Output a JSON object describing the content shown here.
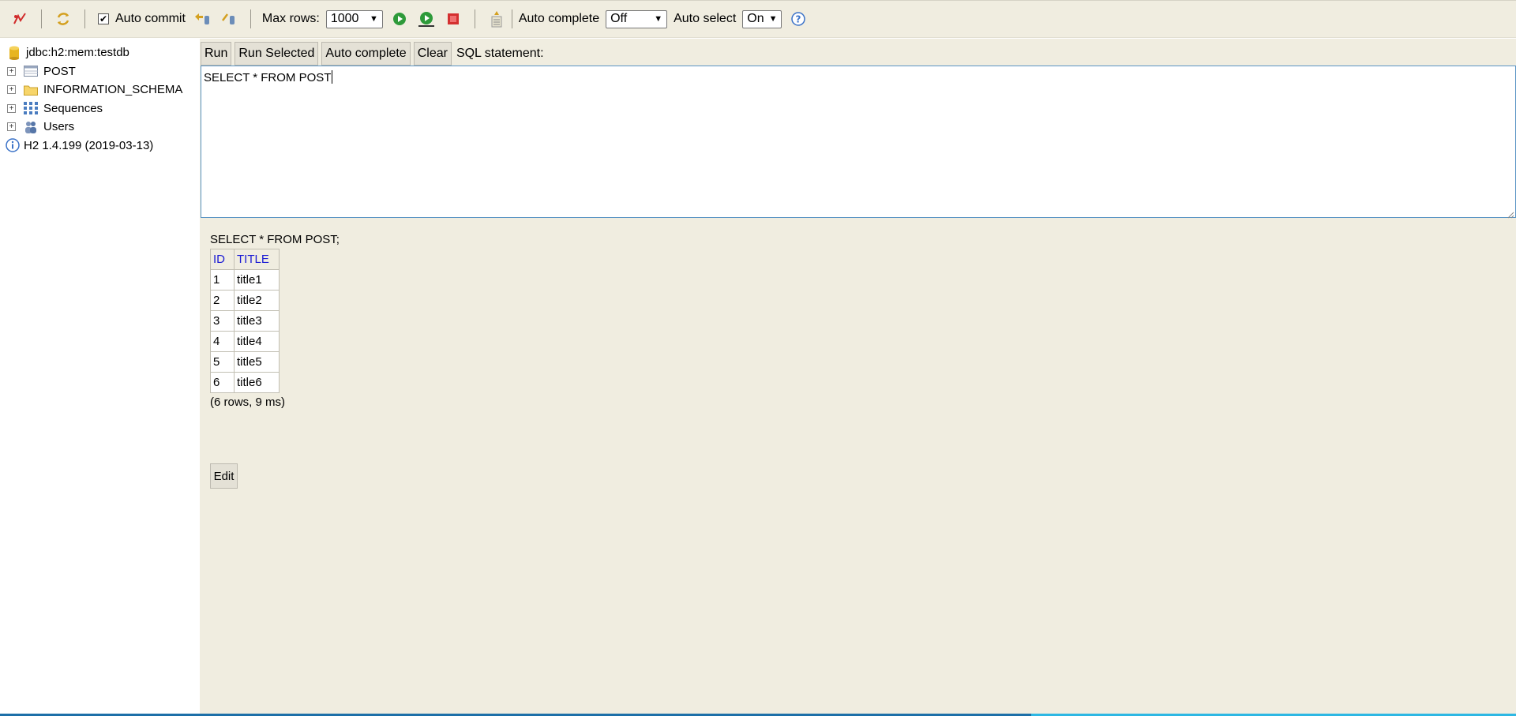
{
  "toolbar": {
    "auto_commit_label": "Auto commit",
    "auto_commit_checked": true,
    "max_rows_label": "Max rows:",
    "max_rows_value": "1000",
    "auto_complete_label": "Auto complete",
    "auto_complete_value": "Off",
    "auto_select_label": "Auto select",
    "auto_select_value": "On",
    "help_glyph": "?"
  },
  "tree": {
    "connection": "jdbc:h2:mem:testdb",
    "items": [
      {
        "label": "POST",
        "icon": "table-icon"
      },
      {
        "label": "INFORMATION_SCHEMA",
        "icon": "folder-icon"
      },
      {
        "label": "Sequences",
        "icon": "sequences-icon"
      },
      {
        "label": "Users",
        "icon": "users-icon"
      }
    ],
    "version": "H2 1.4.199 (2019-03-13)"
  },
  "query": {
    "run_label": "Run",
    "run_selected_label": "Run Selected",
    "auto_complete_label": "Auto complete",
    "clear_label": "Clear",
    "statement_label": "SQL statement:",
    "sql_text": "SELECT * FROM POST"
  },
  "results": {
    "statement": "SELECT * FROM POST;",
    "columns": [
      "ID",
      "TITLE"
    ],
    "rows": [
      [
        "1",
        "title1"
      ],
      [
        "2",
        "title2"
      ],
      [
        "3",
        "title3"
      ],
      [
        "4",
        "title4"
      ],
      [
        "5",
        "title5"
      ],
      [
        "6",
        "title6"
      ]
    ],
    "summary": "(6 rows, 9 ms)",
    "edit_label": "Edit"
  },
  "colors": {
    "toolbar_bg": "#f0ede0",
    "header_link": "#1b1bd4",
    "progress_light": "#2db7e3",
    "progress_dark": "#1c6fa8"
  },
  "progress": {
    "fraction": 0.68
  }
}
